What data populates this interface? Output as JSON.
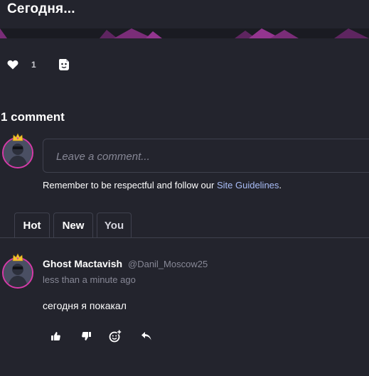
{
  "post": {
    "title": "Сегодня..."
  },
  "actions": {
    "like_count": "1",
    "icons": [
      "heart-icon",
      "sticker-icon"
    ]
  },
  "comments_section": {
    "heading": "1 comment",
    "compose": {
      "placeholder": "Leave a comment...",
      "guidelines_prefix": "Remember to be respectful and follow our ",
      "guidelines_link": "Site Guidelines",
      "guidelines_suffix": "."
    },
    "tabs": [
      {
        "label": "Hot"
      },
      {
        "label": "New"
      },
      {
        "label": "You",
        "active": true
      }
    ],
    "comments": [
      {
        "author": "Ghost Mactavish",
        "handle": "@Danil_Moscow25",
        "time": "less than a minute ago",
        "text": "сегодня я покакал",
        "actions": [
          "thumbs-up-icon",
          "thumbs-down-icon",
          "add-reaction-icon",
          "reply-icon"
        ]
      }
    ]
  },
  "colors": {
    "background": "#23242d",
    "accent_pink": "#d63aa8",
    "link": "#a9bdf7",
    "muted_text": "#878896",
    "border": "#3f414e"
  }
}
